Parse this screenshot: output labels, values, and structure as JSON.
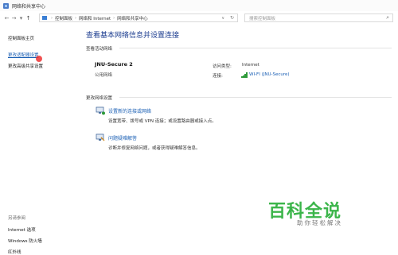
{
  "window": {
    "title": "网络和共享中心"
  },
  "nav": {
    "back": "←",
    "forward": "→",
    "recent": "▾",
    "up": "↑"
  },
  "address": {
    "crumbs": [
      "控制面板",
      "网络和 Internet",
      "网络和共享中心"
    ],
    "separator": "›",
    "dropdown": "∨",
    "refresh": "↻"
  },
  "search": {
    "placeholder": "搜索控制面板",
    "icon": "⌕"
  },
  "sidebar": {
    "items": [
      {
        "label": "控制面板主页"
      },
      {
        "label": "更改适配器设置"
      },
      {
        "label": "更改高级共享设置"
      }
    ],
    "see_also_title": "另请参阅",
    "see_also": [
      {
        "label": "Internet 选项"
      },
      {
        "label": "Windows 防火墙"
      },
      {
        "label": "红外线"
      }
    ]
  },
  "main": {
    "heading": "查看基本网络信息并设置连接",
    "active_networks_label": "查看活动网络",
    "network": {
      "name": "JNU-Secure  2",
      "type": "公用网络",
      "access_type_label": "访问类型:",
      "access_type_value": "Internet",
      "connections_label": "连接:",
      "connection_value": "WI-FI (JNU-Secure)"
    },
    "change_settings_label": "更改网络设置",
    "tasks": [
      {
        "title": "设置新的连接或网络",
        "desc": "设置宽带、拨号或 VPN 连接；或设置路由器或接入点。"
      },
      {
        "title": "问题疑难解答",
        "desc": "诊断并修复网络问题，或者获得疑难解答信息。"
      }
    ]
  },
  "watermark": {
    "brand": "百科全说",
    "tagline": "助你轻松解决"
  },
  "colors": {
    "link": "#1a5fb4",
    "heading": "#1b3c8f",
    "wifi": "#2e9a3a",
    "watermark": "#3bb54a"
  }
}
